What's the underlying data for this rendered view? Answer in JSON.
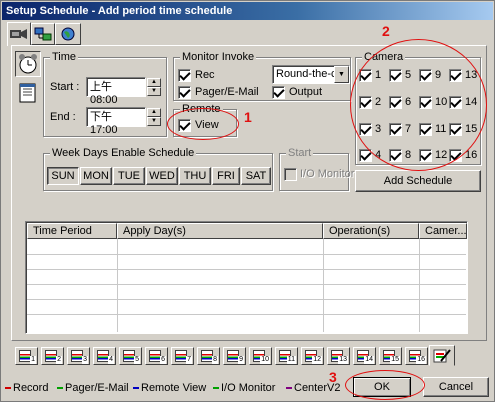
{
  "window": {
    "title": "Setup Schedule - Add period time schedule"
  },
  "toolbar": {
    "tab_icons": [
      "camera-dvr-icon",
      "network-icon",
      "globe-icon"
    ]
  },
  "side_icons": [
    "alarm-clock-icon",
    "notepad-icon"
  ],
  "time": {
    "group_title": "Time",
    "start_label": "Start :",
    "start_value": "上午 08:00",
    "end_label": "End :",
    "end_value": "下午 17:00"
  },
  "monitor": {
    "group_title": "Monitor Invoke",
    "rec_label": "Rec",
    "pager_label": "Pager/E-Mail",
    "output_label": "Output",
    "mode_select": "Round-the-clo"
  },
  "remote": {
    "group_title": "Remote",
    "view_label": "View"
  },
  "camera": {
    "group_title": "Camera",
    "rows": [
      [
        "1",
        "5",
        "9",
        "13"
      ],
      [
        "2",
        "6",
        "10",
        "14"
      ],
      [
        "3",
        "7",
        "11",
        "15"
      ],
      [
        "4",
        "8",
        "12",
        "16"
      ]
    ]
  },
  "weekdays": {
    "group_title": "Week Days Enable Schedule",
    "days": [
      "SUN",
      "MON",
      "TUE",
      "WED",
      "THU",
      "FRI",
      "SAT"
    ]
  },
  "start": {
    "group_title": "Start",
    "io_monitor_label": "I/O Monitor"
  },
  "add_schedule_label": "Add Schedule",
  "table": {
    "columns": [
      "Time Period",
      "Apply Day(s)",
      "Operation(s)",
      "Camer..."
    ]
  },
  "camera_tabs": [
    "1",
    "2",
    "3",
    "4",
    "5",
    "6",
    "7",
    "8",
    "9",
    "10",
    "11",
    "12",
    "13",
    "14",
    "15",
    "16"
  ],
  "legend": [
    {
      "label": "Record",
      "color": "#d00000"
    },
    {
      "label": "Pager/E-Mail",
      "color": "#00a000"
    },
    {
      "label": "Remote View",
      "color": "#0000c0"
    },
    {
      "label": "I/O Monitor",
      "color": "#00a000"
    },
    {
      "label": "CenterV2",
      "color": "#800080"
    }
  ],
  "buttons": {
    "ok": "OK",
    "cancel": "Cancel"
  },
  "annotations": [
    "1",
    "2",
    "3"
  ],
  "colors": {
    "title_start": "#0a246a",
    "title_end": "#a6caf0",
    "annotation": "#e01010"
  }
}
